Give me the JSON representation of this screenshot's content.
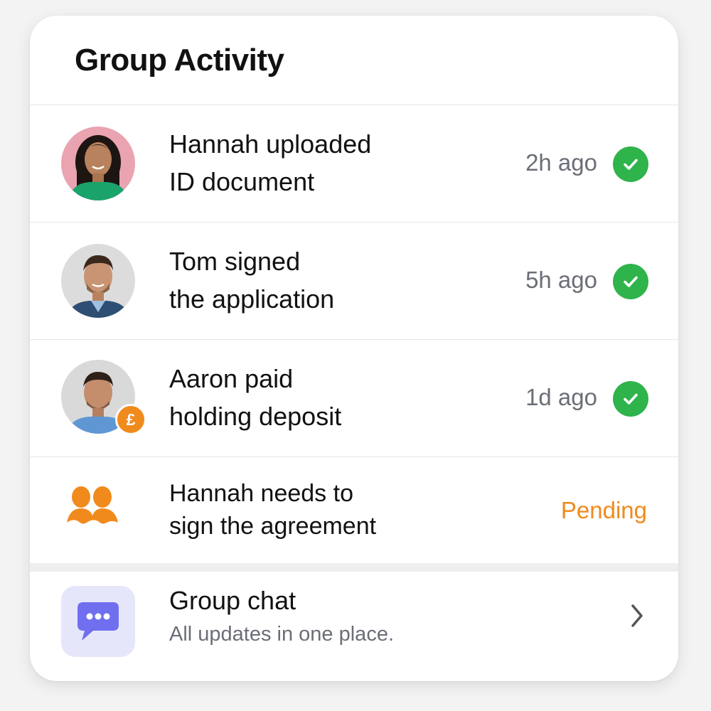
{
  "header": {
    "title": "Group Activity"
  },
  "activities": [
    {
      "line1": "Hannah uploaded",
      "line2": "ID document",
      "time": "2h ago",
      "status": "done"
    },
    {
      "line1": "Tom signed",
      "line2": "the application",
      "time": "5h ago",
      "status": "done"
    },
    {
      "line1": "Aaron paid",
      "line2": "holding deposit",
      "time": "1d ago",
      "status": "done",
      "badge": "£"
    },
    {
      "line1": "Hannah needs to",
      "line2": "sign the agreement",
      "status_label": "Pending"
    }
  ],
  "chat": {
    "title": "Group chat",
    "subtitle": "All updates in one place."
  },
  "colors": {
    "success": "#2fb34b",
    "pending": "#f08a1c",
    "chat_icon": "#6f6ff0",
    "chat_icon_bg": "#e6e6fb"
  },
  "icons": {
    "check": "check-circle-icon",
    "group": "group-people-icon",
    "chat": "chat-bubble-icon",
    "chevron": "chevron-right-icon",
    "currency": "pound-icon"
  }
}
